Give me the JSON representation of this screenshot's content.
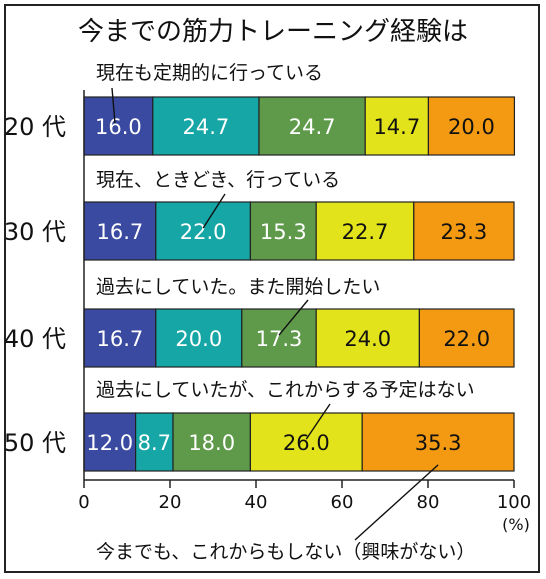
{
  "chart_data": {
    "type": "bar",
    "orientation": "horizontal",
    "stacked": true,
    "title": "今までの筋力トレーニング経験は",
    "categories": [
      "20代",
      "30代",
      "40代",
      "50代"
    ],
    "unit": "(%)",
    "xlim": [
      0,
      100
    ],
    "xticks": [
      "0",
      "20",
      "40",
      "60",
      "80",
      "100"
    ],
    "series": [
      {
        "name": "現在も定期的に行っている",
        "color": "#3a4aa0",
        "values": [
          16.0,
          16.7,
          16.7,
          12.0
        ]
      },
      {
        "name": "現在、ときどき、行っている",
        "color": "#17a6a6",
        "values": [
          24.7,
          22.0,
          20.0,
          8.7
        ]
      },
      {
        "name": "過去にしていた。また開始したい",
        "color": "#5e9a4a",
        "values": [
          24.7,
          15.3,
          17.3,
          18.0
        ]
      },
      {
        "name": "過去にしていたが、これからする予定はない",
        "color": "#e3e31c",
        "values": [
          14.7,
          22.7,
          24.0,
          26.0
        ]
      },
      {
        "name": "今までも、これからもしない（興味がない）",
        "color": "#f39a12",
        "values": [
          20.0,
          23.3,
          22.0,
          35.3
        ]
      }
    ],
    "value_labels": [
      [
        "16.0",
        "24.7",
        "24.7",
        "14.7",
        "20.0"
      ],
      [
        "16.7",
        "22.0",
        "15.3",
        "22.7",
        "23.3"
      ],
      [
        "16.7",
        "20.0",
        "17.3",
        "24.0",
        "22.0"
      ],
      [
        "12.0",
        "8.7",
        "18.0",
        "26.0",
        "35.3"
      ]
    ],
    "grid": false,
    "legend": "callouts"
  }
}
